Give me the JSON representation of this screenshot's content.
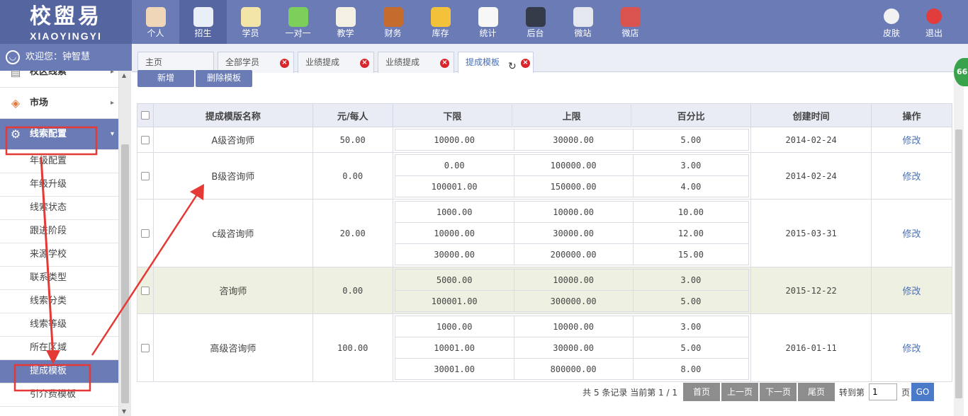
{
  "brand": {
    "cn": "校盥易",
    "en": "XIAOYINGYI"
  },
  "nav": [
    {
      "label": "个人",
      "icon": "person-icon",
      "color": "#f0d6b8"
    },
    {
      "label": "招生",
      "icon": "search-person-icon",
      "color": "#e9eef8"
    },
    {
      "label": "学员",
      "icon": "id-card-icon",
      "color": "#f3e4a8"
    },
    {
      "label": "一对一",
      "icon": "chat-bubbles-icon",
      "color": "#7ccf5a"
    },
    {
      "label": "教学",
      "icon": "pencil-board-icon",
      "color": "#f5f0e4"
    },
    {
      "label": "财务",
      "icon": "briefcase-icon",
      "color": "#c56b2e"
    },
    {
      "label": "库存",
      "icon": "pie-chart-icon",
      "color": "#f3c23a"
    },
    {
      "label": "统计",
      "icon": "bar-chart-icon",
      "color": "#f7f7f7"
    },
    {
      "label": "后台",
      "icon": "monitor-icon",
      "color": "#353b48"
    },
    {
      "label": "微站",
      "icon": "web-page-icon",
      "color": "#e4e7ee"
    },
    {
      "label": "微店",
      "icon": "shop-icon",
      "color": "#d9534f"
    }
  ],
  "right_nav": [
    {
      "label": "皮肤",
      "icon": "palette-icon",
      "color": "#f2f2f2"
    },
    {
      "label": "退出",
      "icon": "power-icon",
      "color": "#e23c3c"
    }
  ],
  "welcome": "欢迎您：钟智慧",
  "tabs": [
    {
      "label": "主页"
    },
    {
      "label": "全部学员"
    },
    {
      "label": "业绩提成"
    },
    {
      "label": "业绩提成"
    },
    {
      "label": "提成模板"
    }
  ],
  "sidebar": {
    "groups": [
      {
        "label": "校区线索"
      },
      {
        "label": "市场"
      },
      {
        "label": "线索配置"
      }
    ],
    "items": [
      "年级配置",
      "年级升级",
      "线索状态",
      "跟进阶段",
      "来源学校",
      "联系类型",
      "线索分类",
      "线索等级",
      "所在区域",
      "提成模板",
      "引介费模板"
    ]
  },
  "buttons": {
    "add": "新增",
    "delete": "删除模板"
  },
  "table": {
    "headers": [
      "提成模版名称",
      "元/每人",
      "下限",
      "上限",
      "百分比",
      "创建时间",
      "操作"
    ],
    "edit_label": "修改",
    "rows": [
      {
        "name": "A级咨询师",
        "per": "50.00",
        "date": "2014-02-24",
        "tiers": [
          [
            "10000.00",
            "30000.00",
            "5.00"
          ]
        ]
      },
      {
        "name": "B级咨询师",
        "per": "0.00",
        "date": "2014-02-24",
        "tiers": [
          [
            "0.00",
            "100000.00",
            "3.00"
          ],
          [
            "100001.00",
            "150000.00",
            "4.00"
          ]
        ]
      },
      {
        "name": "c级咨询师",
        "per": "20.00",
        "date": "2015-03-31",
        "tiers": [
          [
            "1000.00",
            "10000.00",
            "10.00"
          ],
          [
            "10000.00",
            "30000.00",
            "12.00"
          ],
          [
            "30000.00",
            "200000.00",
            "15.00"
          ]
        ]
      },
      {
        "name": "咨询师",
        "per": "0.00",
        "date": "2015-12-22",
        "tiers": [
          [
            "5000.00",
            "10000.00",
            "3.00"
          ],
          [
            "100001.00",
            "300000.00",
            "5.00"
          ]
        ]
      },
      {
        "name": "高级咨询师",
        "per": "100.00",
        "date": "2016-01-11",
        "tiers": [
          [
            "1000.00",
            "10000.00",
            "3.00"
          ],
          [
            "10001.00",
            "30000.00",
            "5.00"
          ],
          [
            "30001.00",
            "800000.00",
            "8.00"
          ]
        ]
      }
    ]
  },
  "pager": {
    "summary": "共 5 条记录 当前第 1 / 1",
    "first": "首页",
    "prev": "上一页",
    "next": "下一页",
    "last": "尾页",
    "goto": "转到第",
    "page_value": "1",
    "page_unit": "页",
    "go": "GO"
  },
  "badge": "66",
  "colors": {
    "header": "#6a7bb6",
    "logo_bg": "#55659f",
    "highlight_row": "#eef1e1",
    "annotation": "#e53935",
    "link": "#4a6fb5"
  }
}
